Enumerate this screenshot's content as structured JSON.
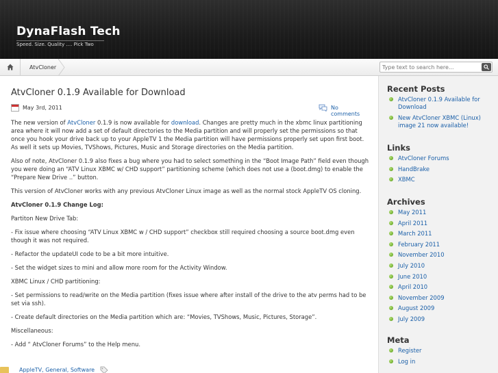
{
  "site": {
    "title": "DynaFlash Tech",
    "description": "Speed. Size. Quality .... Pick Two"
  },
  "nav": {
    "home_icon": "home-icon",
    "breadcrumb": "AtvCloner",
    "search_placeholder": "Type text to search here..."
  },
  "post": {
    "title": "AtvCloner 0.1.9 Available for Download",
    "date": "May 3rd, 2011",
    "comments": "No comments",
    "p1_a": "The new version of ",
    "p1_link1": "AtvCloner",
    "p1_b": " 0.1.9 is now available for ",
    "p1_link2": "download",
    "p1_c": ". Changes are pretty much in the xbmc linux partitioning area where it will now add a set of default directories to the Media partition and will properly set the permissions so that once you hook your drive back up to your AppleTV 1 the Media partition will have permissions properly set upon first boot. As well it sets up Movies, TVShows, Pictures, Music and Storage directories on the Media partition.",
    "p2": "Also of note, AtvCloner 0.1.9 also fixes a bug where you had to select something in the “Boot Image Path” field even though you were doing an “ATV Linux XBMC w/ CHD support” partitioning scheme (which does not use a (boot.dmg) to enable the “Prepare New Drive ..” button.",
    "p3": "This version of AtvCloner works with any previous AtvCloner Linux image as well as the normal stock AppleTV OS cloning.",
    "changelog_heading": "AtvCloner 0.1.9 Change Log:",
    "p5": "Partiton New Drive Tab:",
    "p6": "- Fix issue where choosing “ATV Linux XBMC w / CHD support” checkbox still required choosing a source boot.dmg even though it was not required.",
    "p7": "- Refactor the updateUI code to be a bit more intuitive.",
    "p8": "- Set the widget sizes to mini and allow more room for the Activity Window.",
    "p9": "XBMC Linux / CHD partitioning:",
    "p10": "- Set permissions to read/write on the Media partition (fixes issue where after install of the drive to the atv perms had to be set via ssh).",
    "p11": "- Create default directories on the Media partition which are: “Movies, TVShows, Music, Pictures, Storage”.",
    "p12": "Miscellaneous:",
    "p13": "- Add “ AtvCloner Forums” to the Help menu.",
    "categories": "AppleTV, General, Software"
  },
  "sidebar": {
    "recent_title": "Recent Posts",
    "recent": [
      "AtvCloner 0.1.9 Available for Download",
      "New AtvCloner XBMC (Linux) image 21 now available!"
    ],
    "links_title": "Links",
    "links": [
      "AtvCloner Forums",
      "HandBrake",
      "XBMC"
    ],
    "archives_title": "Archives",
    "archives": [
      "May 2011",
      "April 2011",
      "March 2011",
      "February 2011",
      "November 2010",
      "July 2010",
      "June 2010",
      "April 2010",
      "November 2009",
      "August 2009",
      "July 2009"
    ],
    "meta_title": "Meta",
    "meta": [
      "Register",
      "Log in"
    ]
  }
}
